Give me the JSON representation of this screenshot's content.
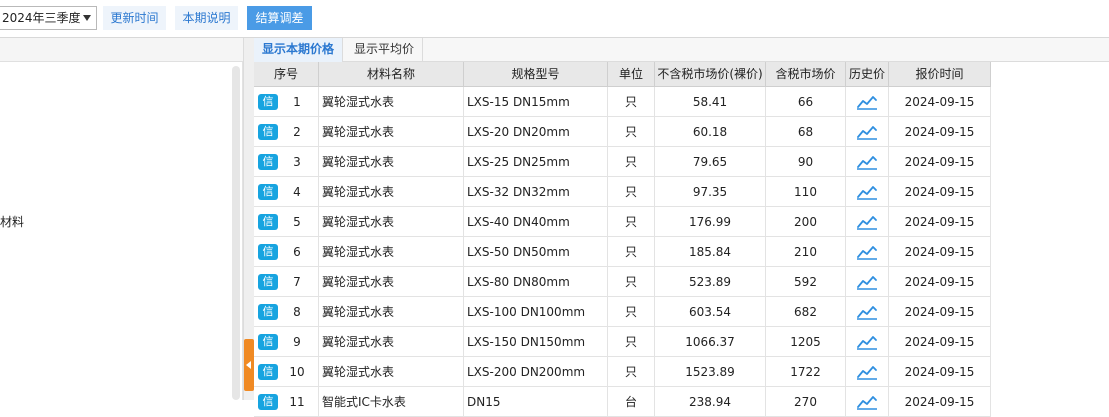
{
  "toolbar": {
    "period_value": "2024年三季度",
    "update_time_label": "更新时间",
    "period_note_label": "本期说明",
    "settlement_label": "结算调差"
  },
  "left_panel": {
    "label": "材料"
  },
  "tabs": [
    {
      "label": "显示本期价格",
      "active": true
    },
    {
      "label": "显示平均价",
      "active": false
    }
  ],
  "grid": {
    "columns": [
      "序号",
      "材料名称",
      "规格型号",
      "单位",
      "不含税市场价(裸价)",
      "含税市场价",
      "历史价",
      "报价时间"
    ],
    "badge_label": "信",
    "rows": [
      {
        "seq": "1",
        "name": "翼轮湿式水表",
        "spec": "LXS-15 DN15mm",
        "unit": "只",
        "price_ex": "58.41",
        "price_inc": "66",
        "date": "2024-09-15"
      },
      {
        "seq": "2",
        "name": "翼轮湿式水表",
        "spec": "LXS-20 DN20mm",
        "unit": "只",
        "price_ex": "60.18",
        "price_inc": "68",
        "date": "2024-09-15"
      },
      {
        "seq": "3",
        "name": "翼轮湿式水表",
        "spec": "LXS-25 DN25mm",
        "unit": "只",
        "price_ex": "79.65",
        "price_inc": "90",
        "date": "2024-09-15"
      },
      {
        "seq": "4",
        "name": "翼轮湿式水表",
        "spec": "LXS-32 DN32mm",
        "unit": "只",
        "price_ex": "97.35",
        "price_inc": "110",
        "date": "2024-09-15"
      },
      {
        "seq": "5",
        "name": "翼轮湿式水表",
        "spec": "LXS-40 DN40mm",
        "unit": "只",
        "price_ex": "176.99",
        "price_inc": "200",
        "date": "2024-09-15"
      },
      {
        "seq": "6",
        "name": "翼轮湿式水表",
        "spec": "LXS-50 DN50mm",
        "unit": "只",
        "price_ex": "185.84",
        "price_inc": "210",
        "date": "2024-09-15"
      },
      {
        "seq": "7",
        "name": "翼轮湿式水表",
        "spec": "LXS-80 DN80mm",
        "unit": "只",
        "price_ex": "523.89",
        "price_inc": "592",
        "date": "2024-09-15"
      },
      {
        "seq": "8",
        "name": "翼轮湿式水表",
        "spec": "LXS-100 DN100mm",
        "unit": "只",
        "price_ex": "603.54",
        "price_inc": "682",
        "date": "2024-09-15"
      },
      {
        "seq": "9",
        "name": "翼轮湿式水表",
        "spec": "LXS-150 DN150mm",
        "unit": "只",
        "price_ex": "1066.37",
        "price_inc": "1205",
        "date": "2024-09-15"
      },
      {
        "seq": "10",
        "name": "翼轮湿式水表",
        "spec": "LXS-200 DN200mm",
        "unit": "只",
        "price_ex": "1523.89",
        "price_inc": "1722",
        "date": "2024-09-15"
      },
      {
        "seq": "11",
        "name": "智能式IC卡水表",
        "spec": "DN15",
        "unit": "台",
        "price_ex": "238.94",
        "price_inc": "270",
        "date": "2024-09-15"
      }
    ]
  },
  "colors": {
    "accent": "#4a9be6",
    "badge": "#17a4e0",
    "splitter_handle": "#f08a24"
  }
}
